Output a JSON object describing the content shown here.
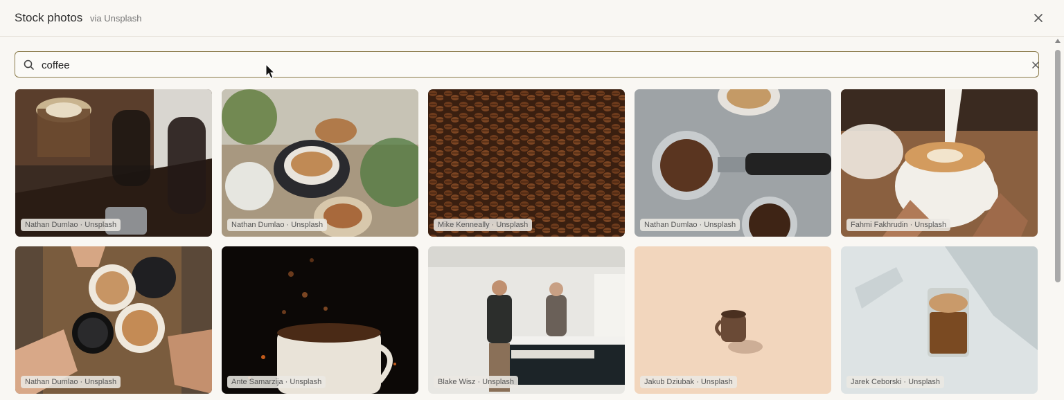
{
  "header": {
    "title": "Stock photos",
    "subtitle": "via Unsplash",
    "close_icon": "close-icon"
  },
  "search": {
    "value": "coffee",
    "icon": "search-icon",
    "clear_icon": "clear-icon"
  },
  "photos": [
    {
      "credit": "Nathan Dumlao · Unsplash",
      "subject": "latte glasses and carafes on wooden table"
    },
    {
      "credit": "Nathan Dumlao · Unsplash",
      "subject": "cappuccinos with plants"
    },
    {
      "credit": "Mike Kenneally · Unsplash",
      "subject": "roasted coffee beans"
    },
    {
      "credit": "Nathan Dumlao · Unsplash",
      "subject": "portafilter with ground coffee"
    },
    {
      "credit": "Fahmi Fakhrudin · Unsplash",
      "subject": "latte art pour"
    },
    {
      "credit": "Nathan Dumlao · Unsplash",
      "subject": "hands toasting latte cups"
    },
    {
      "credit": "Ante Samarzija · Unsplash",
      "subject": "beans falling into cup"
    },
    {
      "credit": "Blake Wisz · Unsplash",
      "subject": "coffee shop counter"
    },
    {
      "credit": "Jakub Dziubak · Unsplash",
      "subject": "small cup on peach background"
    },
    {
      "credit": "Jarek Ceborski · Unsplash",
      "subject": "glass of coffee in sunlight"
    }
  ],
  "colors": {
    "search_border": "#8a7a4a",
    "background": "#f9f7f3"
  }
}
